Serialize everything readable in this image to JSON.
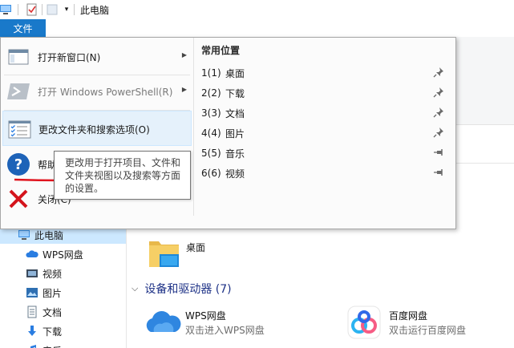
{
  "titlebar": {
    "title": "此电脑",
    "icons": [
      "computer-icon",
      "properties-icon",
      "new-folder-icon",
      "customize-dropdown-icon"
    ]
  },
  "file_tab": {
    "label": "文件"
  },
  "file_menu": {
    "items": [
      {
        "label": "打开新窗口(N)",
        "has_submenu": true,
        "icon": "new-window-icon"
      },
      {
        "label": "打开 Windows PowerShell(R)",
        "has_submenu": true,
        "disabled": true,
        "icon": "powershell-icon"
      },
      {
        "label": "更改文件夹和搜索选项(O)",
        "icon": "folder-options-icon",
        "highlighted": true
      },
      {
        "label": "帮助",
        "icon": "help-icon"
      },
      {
        "label": "关闭(C)",
        "icon": "close-icon"
      }
    ],
    "recent": {
      "title": "常用位置",
      "items": [
        {
          "num": "1(1)",
          "name": "桌面",
          "pinned": true
        },
        {
          "num": "2(2)",
          "name": "下载",
          "pinned": true
        },
        {
          "num": "3(3)",
          "name": "文档",
          "pinned": true
        },
        {
          "num": "4(4)",
          "name": "图片",
          "pinned": true
        },
        {
          "num": "5(5)",
          "name": "音乐",
          "pinned": false
        },
        {
          "num": "6(6)",
          "name": "视频",
          "pinned": false
        }
      ]
    }
  },
  "tooltip": {
    "text": "更改用于打开项目、文件和文件夹视图以及搜索等方面的设置。"
  },
  "nav_pane": {
    "items": [
      {
        "label": "此电脑",
        "icon": "this-pc-icon",
        "selected": true
      },
      {
        "label": "WPS网盘",
        "icon": "wps-cloud-icon"
      },
      {
        "label": "视频",
        "icon": "videos-icon"
      },
      {
        "label": "图片",
        "icon": "pictures-icon"
      },
      {
        "label": "文档",
        "icon": "documents-icon"
      },
      {
        "label": "下载",
        "icon": "downloads-icon"
      },
      {
        "label": "音乐",
        "icon": "music-icon"
      }
    ]
  },
  "content": {
    "desktop_label": "桌面",
    "group_header": "设备和驱动器 (7)",
    "drives": [
      {
        "name": "WPS网盘",
        "sub": "双击进入WPS网盘",
        "icon": "wps-cloud-icon"
      },
      {
        "name": "百度网盘",
        "sub": "双击运行百度网盘",
        "icon": "baidu-netdisk-icon"
      }
    ]
  },
  "colors": {
    "accent": "#1979ca",
    "hover": "#e5f1fb",
    "annotation": "#e0141e"
  }
}
